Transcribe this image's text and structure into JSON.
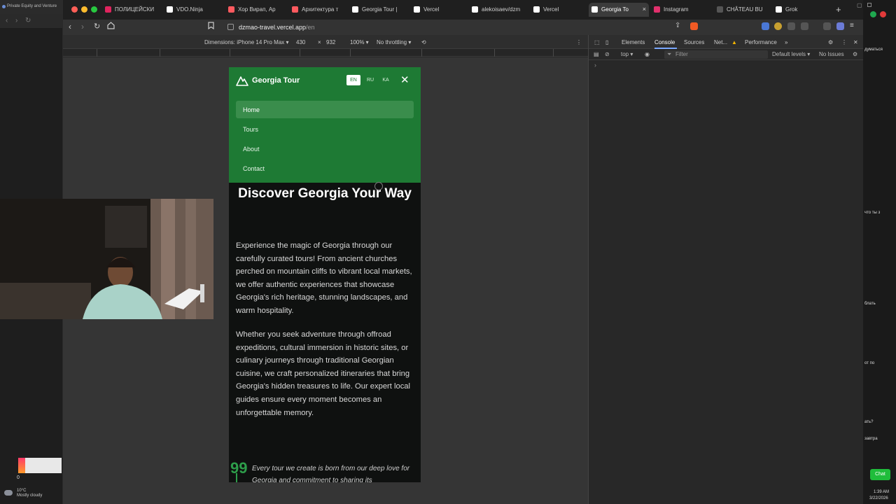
{
  "left_window": {
    "tab_title": "Private Equity and Venture",
    "weather_temp": "10°C",
    "weather_desc": "Mostly cloudy",
    "counter": "0"
  },
  "browser": {
    "tabs": [
      {
        "label": "ПОЛИЦЕЙСКИ",
        "icon_color": "#e0245e"
      },
      {
        "label": "VDO.Ninja",
        "icon_color": "#ffffff"
      },
      {
        "label": "Хор Вирап, Ар",
        "icon_color": "#ff5a5f"
      },
      {
        "label": "Архитектура т",
        "icon_color": "#ff5a5f"
      },
      {
        "label": "Georgia Tour |",
        "icon_color": "#ffffff"
      },
      {
        "label": "Vercel",
        "icon_color": "#ffffff"
      },
      {
        "label": "alekoisaev/dzm",
        "icon_color": "#ffffff"
      },
      {
        "label": "Vercel",
        "icon_color": "#ffffff"
      },
      {
        "label": "Georgia To",
        "icon_color": "#ffffff",
        "active": true
      },
      {
        "label": "Instagram",
        "icon_color": "#e1306c"
      },
      {
        "label": "CHÂTEAU BU",
        "icon_color": "#555555"
      },
      {
        "label": "Grok",
        "icon_color": "#ffffff"
      }
    ],
    "close_tab": "×",
    "new_tab": "+",
    "url_host": "dzmao-travel.vercel.app",
    "url_path": "/en"
  },
  "device_toolbar": {
    "dimensions_label": "Dimensions: iPhone 14 Pro Max ▾",
    "width": "430",
    "times": "×",
    "height": "932",
    "zoom": "100% ▾",
    "throttling": "No throttling ▾",
    "more": "⋮"
  },
  "page": {
    "brand": "Georgia Tour",
    "languages": [
      "EN",
      "RU",
      "KA"
    ],
    "active_language": "EN",
    "close": "✕",
    "menu": [
      "Home",
      "Tours",
      "About",
      "Contact"
    ],
    "active_menu": "Home",
    "hero_title": "Discover Georgia Your Way",
    "paragraph_1": "Experience the magic of Georgia through our carefully curated tours! From ancient churches perched on mountain cliffs to vibrant local markets, we offer authentic experiences that showcase Georgia's rich heritage, stunning landscapes, and warm hospitality.",
    "paragraph_2": "Whether you seek adventure through offroad expeditions, cultural immersion in historic sites, or culinary journeys through traditional Georgian cuisine, we craft personalized itineraries that bring Georgia's hidden treasures to life. Our expert local guides ensure every moment becomes an unforgettable memory.",
    "quote": "Every tour we create is born from our deep love for Georgia and commitment to sharing its",
    "quote_mark": "99"
  },
  "devtools": {
    "tabs": [
      "Elements",
      "Console",
      "Sources",
      "Net...",
      "Performance"
    ],
    "active_tab": "Console",
    "context": "top ▾",
    "filter_placeholder": "Filter",
    "levels": "Default levels ▾",
    "issues": "No Issues",
    "prompt": "›",
    "overflow": "»",
    "close": "✕"
  },
  "right_window": {
    "lines": [
      "думаться",
      "что ты з",
      "блать",
      "от по",
      "ать?",
      "завтра"
    ],
    "chat_label": "Chat",
    "time": "1:39 AM",
    "date": "3/22/2026"
  }
}
